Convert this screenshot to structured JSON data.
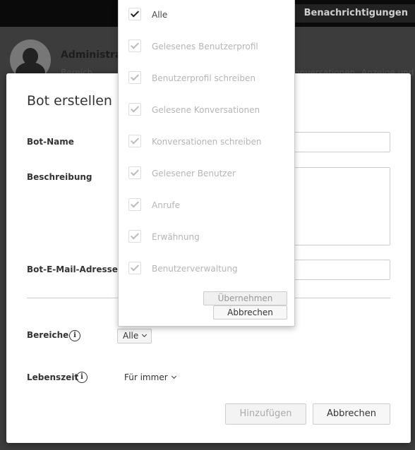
{
  "background": {
    "notifications_label": "Benachrichtigungen",
    "user_name": "Administrator",
    "tabs": [
      "Bereich",
      "Konversationen",
      "Anzeige und Ton"
    ]
  },
  "modal": {
    "title": "Bot erstellen",
    "fields": {
      "bot_name_label": "Bot-Name",
      "bot_name_value": "",
      "description_label": "Beschreibung",
      "description_value": "",
      "email_label": "Bot-E-Mail-Adresse",
      "email_value": ""
    },
    "scopes": {
      "label": "Bereiche",
      "info_icon": "i",
      "selected": "Alle"
    },
    "lifetime": {
      "label": "Lebenszeit",
      "info_icon": "i",
      "selected": "Für immer"
    },
    "buttons": {
      "add": "Hinzufügen",
      "cancel": "Abbrechen"
    }
  },
  "scope_dropdown": {
    "items": [
      {
        "label": "Alle",
        "checked": true,
        "enabled": true
      },
      {
        "label": "Gelesenes Benutzerprofil",
        "checked": true,
        "enabled": false
      },
      {
        "label": "Benutzerprofil schreiben",
        "checked": true,
        "enabled": false
      },
      {
        "label": "Gelesene Konversationen",
        "checked": true,
        "enabled": false
      },
      {
        "label": "Konversationen schreiben",
        "checked": true,
        "enabled": false
      },
      {
        "label": "Gelesener Benutzer",
        "checked": true,
        "enabled": false
      },
      {
        "label": "Anrufe",
        "checked": true,
        "enabled": false
      },
      {
        "label": "Erwähnung",
        "checked": true,
        "enabled": false
      },
      {
        "label": "Benutzerverwaltung",
        "checked": true,
        "enabled": false
      }
    ],
    "apply_label": "Übernehmen",
    "cancel_label": "Abbrechen"
  }
}
